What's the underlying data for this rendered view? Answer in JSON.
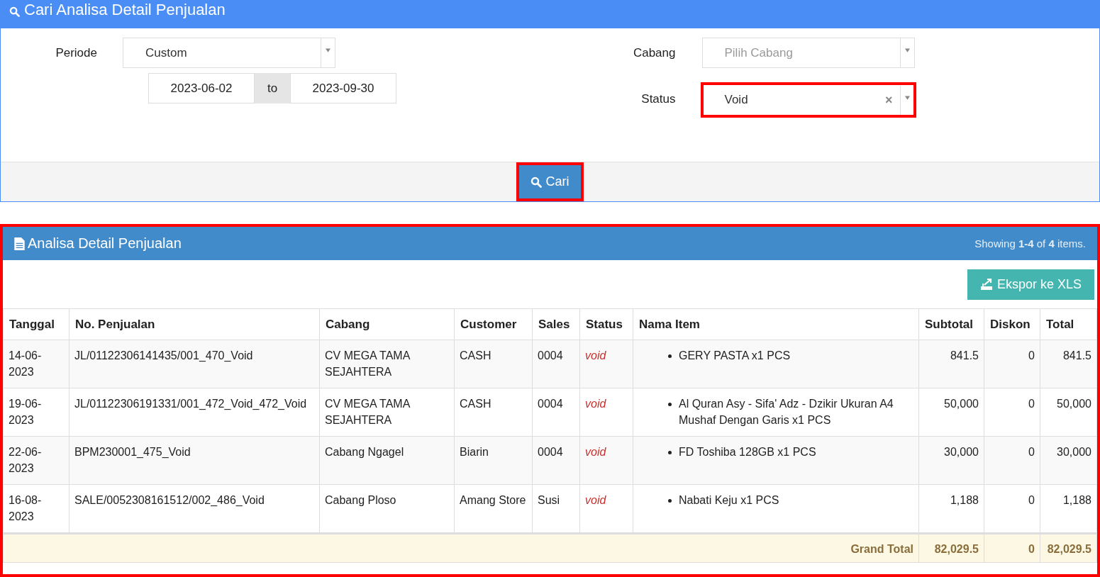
{
  "search_panel": {
    "title": "Cari Analisa Detail Penjualan",
    "periode": {
      "label": "Periode",
      "value": "Custom",
      "date_from": "2023-06-02",
      "separator": "to",
      "date_to": "2023-09-30"
    },
    "cabang": {
      "label": "Cabang",
      "placeholder": "Pilih Cabang"
    },
    "status": {
      "label": "Status",
      "value": "Void",
      "clear": "×",
      "highlighted": true
    },
    "search_button": {
      "label": "Cari",
      "highlighted": true
    }
  },
  "results_panel": {
    "title": "Analisa Detail Penjualan",
    "summary": "Showing **1-4** of **4** items.",
    "highlighted": true,
    "export_button": "Ekspor ke XLS",
    "table": {
      "columns": [
        "Tanggal",
        "No. Penjualan",
        "Cabang",
        "Customer",
        "Sales",
        "Status",
        "Nama Item",
        "Subtotal",
        "Diskon",
        "Total"
      ],
      "rows": [
        {
          "tanggal": "14-06-2023",
          "no": "JL/01122306141435/001_470_Void",
          "cabang": "CV MEGA TAMA SEJAHTERA",
          "customer": "CASH",
          "sales": "0004",
          "status": "void",
          "items": [
            "GERY PASTA x1 PCS"
          ],
          "subtotal": "841.5",
          "diskon": "0",
          "total": "841.5"
        },
        {
          "tanggal": "19-06-2023",
          "no": "JL/01122306191331/001_472_Void_472_Void",
          "cabang": "CV MEGA TAMA SEJAHTERA",
          "customer": "CASH",
          "sales": "0004",
          "status": "void",
          "items": [
            "Al Quran Asy - Sifa' Adz - Dzikir Ukuran A4 Mushaf Dengan Garis x1 PCS"
          ],
          "subtotal": "50,000",
          "diskon": "0",
          "total": "50,000"
        },
        {
          "tanggal": "22-06-2023",
          "no": "BPM230001_475_Void",
          "cabang": "Cabang Ngagel",
          "customer": "Biarin",
          "sales": "0004",
          "status": "void",
          "items": [
            "FD Toshiba 128GB x1 PCS"
          ],
          "subtotal": "30,000",
          "diskon": "0",
          "total": "30,000"
        },
        {
          "tanggal": "16-08-2023",
          "no": "SALE/0052308161512/002_486_Void",
          "cabang": "Cabang Ploso",
          "customer": "Amang Store",
          "sales": "Susi",
          "status": "void",
          "items": [
            "Nabati Keju x1 PCS"
          ],
          "subtotal": "1,188",
          "diskon": "0",
          "total": "1,188"
        }
      ],
      "footer": {
        "label": "Grand Total",
        "subtotal": "82,029.5",
        "diskon": "0",
        "total": "82,029.5"
      }
    }
  }
}
